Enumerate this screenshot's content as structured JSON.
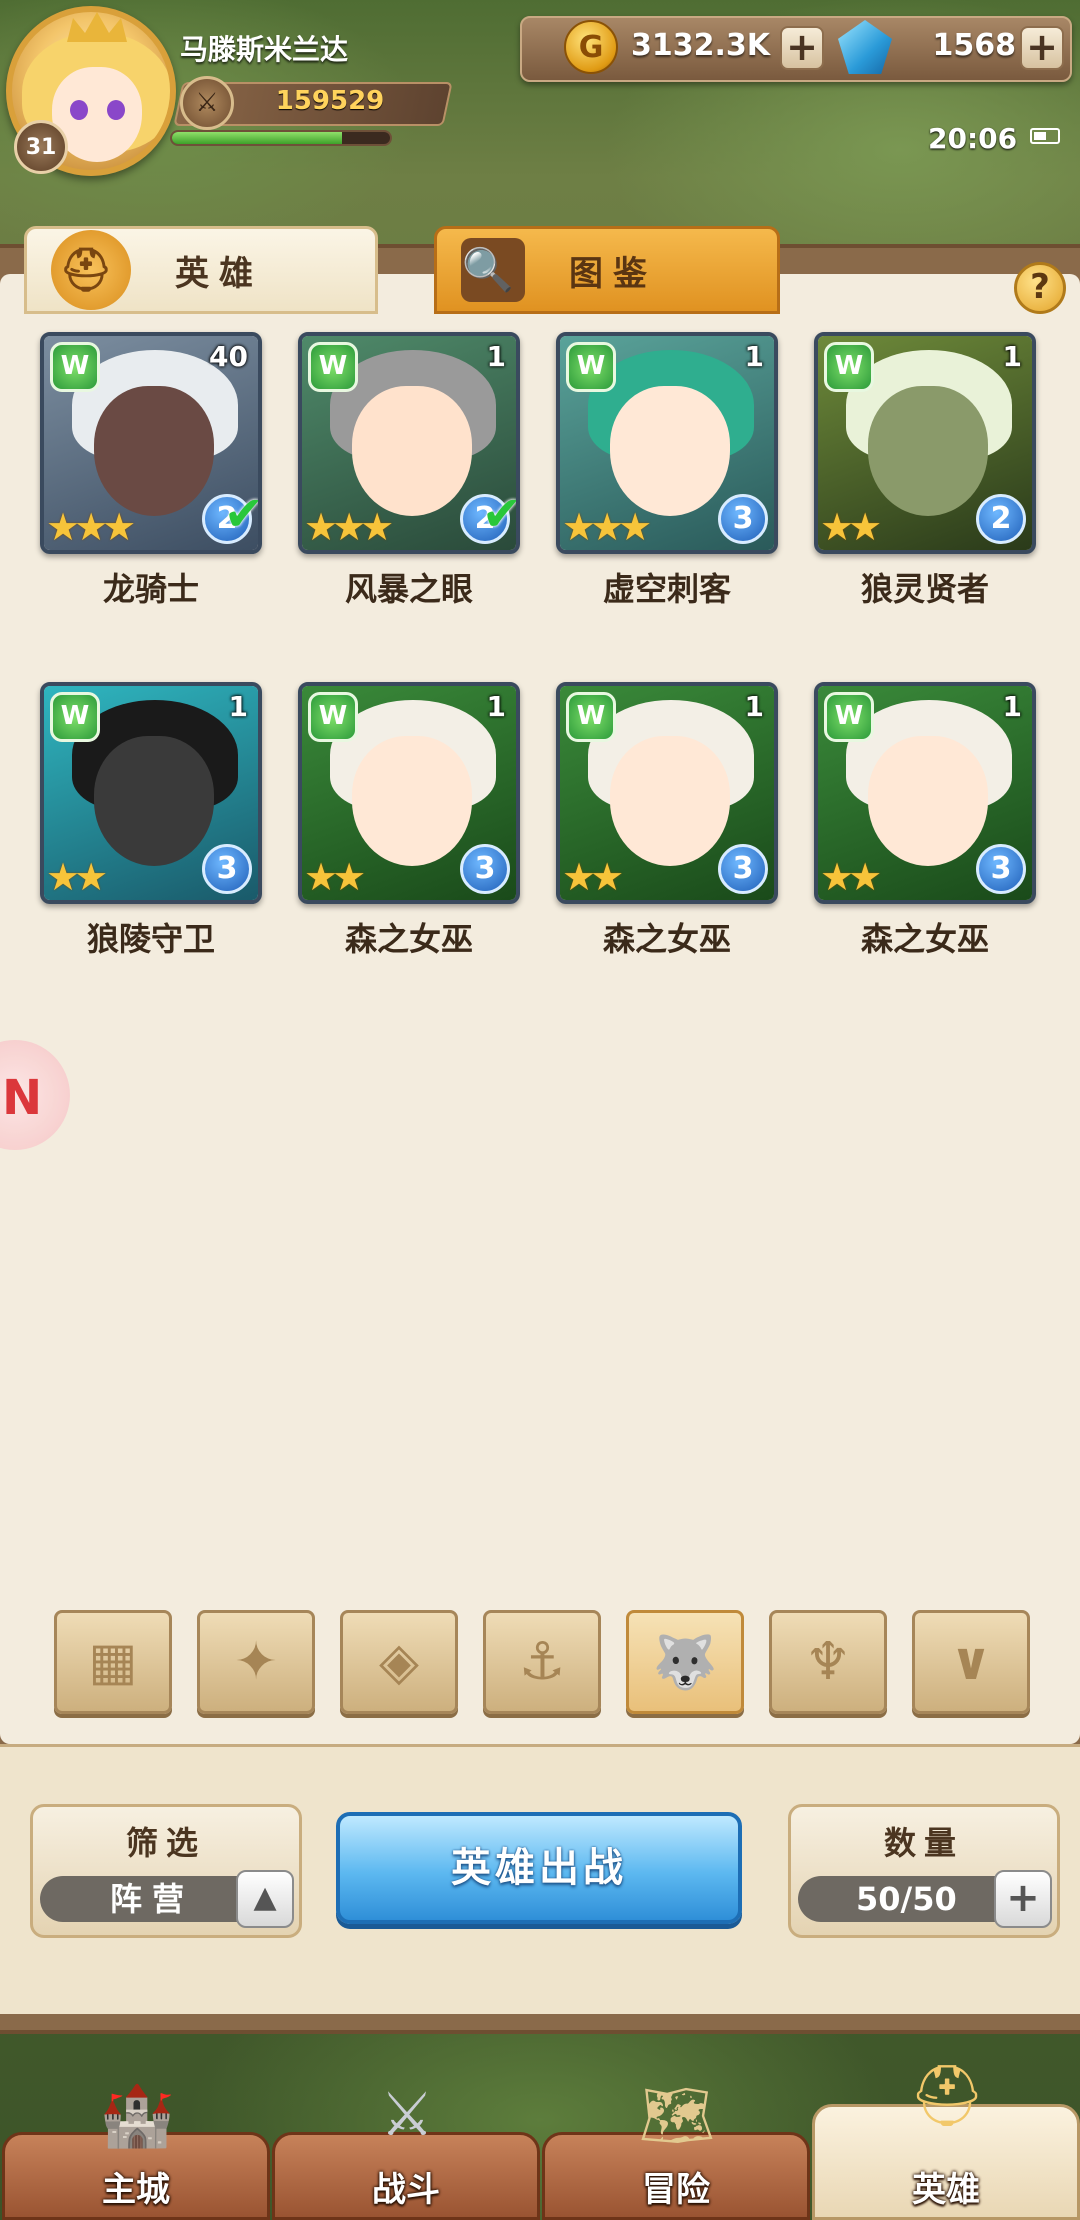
{
  "player": {
    "name": "马滕斯米兰达",
    "level": "31",
    "power": "159529",
    "exp_fraction": 0.78
  },
  "currency": {
    "gold": "3132.3K",
    "gems": "1568"
  },
  "status": {
    "time": "20:06"
  },
  "tabs": {
    "heroes": "英雄",
    "codex": "图鉴",
    "help": "?"
  },
  "heroes": [
    {
      "name": "龙骑士",
      "level": "40",
      "stars": 3,
      "rank": "2",
      "deployed": true,
      "faction_icon": "wolf-faction-icon"
    },
    {
      "name": "风暴之眼",
      "level": "1",
      "stars": 3,
      "rank": "2",
      "deployed": true,
      "faction_icon": "wolf-faction-icon"
    },
    {
      "name": "虚空刺客",
      "level": "1",
      "stars": 3,
      "rank": "3",
      "deployed": false,
      "faction_icon": "wolf-faction-icon"
    },
    {
      "name": "狼灵贤者",
      "level": "1",
      "stars": 2,
      "rank": "2",
      "deployed": false,
      "faction_icon": "wolf-faction-icon"
    },
    {
      "name": "狼陵守卫",
      "level": "1",
      "stars": 2,
      "rank": "3",
      "deployed": false,
      "faction_icon": "wolf-faction-icon"
    },
    {
      "name": "森之女巫",
      "level": "1",
      "stars": 2,
      "rank": "3",
      "deployed": false,
      "faction_icon": "wolf-faction-icon"
    },
    {
      "name": "森之女巫",
      "level": "1",
      "stars": 2,
      "rank": "3",
      "deployed": false,
      "faction_icon": "wolf-faction-icon"
    },
    {
      "name": "森之女巫",
      "level": "1",
      "stars": 2,
      "rank": "3",
      "deployed": false,
      "faction_icon": "wolf-faction-icon"
    }
  ],
  "faction_filters": [
    {
      "icon": "grid-all-icon",
      "glyph": "▦",
      "active": false
    },
    {
      "icon": "leaf-faction-icon",
      "glyph": "✦",
      "active": false
    },
    {
      "icon": "diamond-faction-icon",
      "glyph": "◈",
      "active": false
    },
    {
      "icon": "anchor-faction-icon",
      "glyph": "⚓",
      "active": false
    },
    {
      "icon": "wolf-faction-icon",
      "glyph": "🐺",
      "active": true
    },
    {
      "icon": "demon-faction-icon",
      "glyph": "♆",
      "active": false
    },
    {
      "icon": "horns-faction-icon",
      "glyph": "∨",
      "active": false
    }
  ],
  "controls": {
    "filter_title": "筛选",
    "filter_value": "阵营",
    "deploy_button": "英雄出战",
    "count_title": "数量",
    "count_value": "50/50"
  },
  "nav": [
    {
      "label": "主城",
      "icon": "castle-icon",
      "active": false
    },
    {
      "label": "战斗",
      "icon": "crossed-swords-icon",
      "active": false
    },
    {
      "label": "冒险",
      "icon": "map-scroll-icon",
      "active": false
    },
    {
      "label": "英雄",
      "icon": "hero-helmet-icon",
      "active": true
    }
  ],
  "colors": {
    "accent_orange": "#e09221",
    "deploy_blue": "#2f8fd8",
    "star_gold": "#f7c43a",
    "rank_blue": "#1f5fb8",
    "check_green": "#29c73a"
  }
}
